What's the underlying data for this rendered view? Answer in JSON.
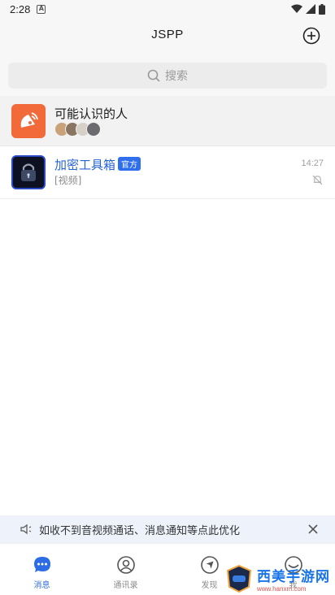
{
  "status_bar": {
    "time": "2:28",
    "badge": "A"
  },
  "app_bar": {
    "title": "JSPP"
  },
  "search": {
    "placeholder": "搜索"
  },
  "people_row": {
    "title": "可能认识的人"
  },
  "chat_row": {
    "name": "加密工具箱",
    "tag": "官方",
    "preview": "[视频]",
    "time": "14:27"
  },
  "notice": {
    "text": "如收不到音视频通话、消息通知等点此优化"
  },
  "tabs": [
    {
      "label": "消息",
      "icon": "message-icon",
      "active": true
    },
    {
      "label": "通讯录",
      "icon": "contacts-icon",
      "active": false
    },
    {
      "label": "发现",
      "icon": "discover-icon",
      "active": false
    },
    {
      "label": "我",
      "icon": "profile-icon",
      "active": false
    }
  ],
  "watermark": {
    "text": "西美手游网",
    "url": "www.hanxm.com"
  },
  "colors": {
    "accent": "#2e6ce6",
    "orange": "#f26a3a",
    "tag": "#2f6fed",
    "notice_bg": "#eef3fb"
  }
}
